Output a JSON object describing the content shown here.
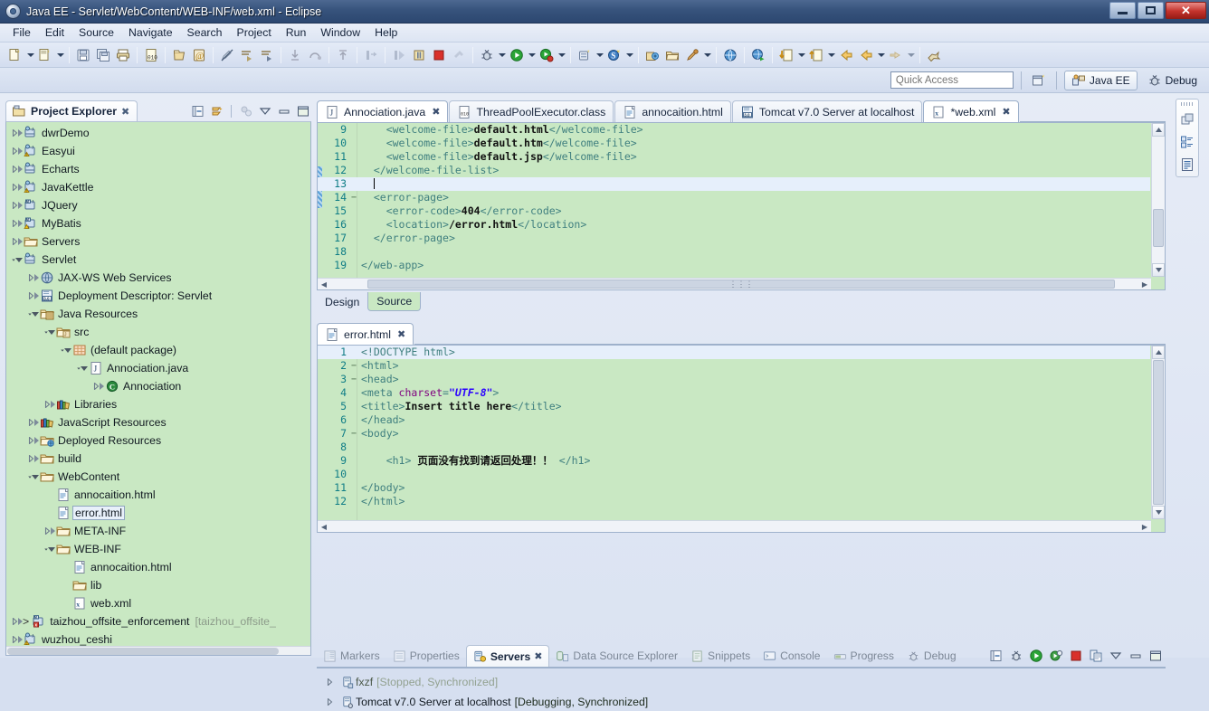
{
  "window": {
    "title": "Java EE - Servlet/WebContent/WEB-INF/web.xml - Eclipse",
    "minimize_label": "–",
    "maximize_label": "❐",
    "close_label": "✕"
  },
  "menu": {
    "items": [
      "File",
      "Edit",
      "Source",
      "Navigate",
      "Search",
      "Project",
      "Run",
      "Window",
      "Help"
    ]
  },
  "toolbar": {
    "buttons": [
      {
        "name": "new-wizard",
        "icon": "new-file-icon"
      },
      {
        "name": "new-wizard-dropdown",
        "icon": "chevron-down-icon"
      },
      {
        "name": "new-java-project",
        "icon": "new-project-icon"
      },
      {
        "name": "new-java-project-dropdown",
        "icon": "chevron-down-icon"
      },
      {
        "name": "save",
        "icon": "save-icon"
      },
      {
        "name": "save-all",
        "icon": "save-all-icon"
      },
      {
        "name": "print",
        "icon": "print-icon"
      },
      {
        "name": "toggle-breakpoint",
        "icon": "binary-icon"
      },
      {
        "name": "new-jsp",
        "icon": "document-icon"
      },
      {
        "name": "new-annotation",
        "icon": "at-sign-icon"
      },
      {
        "name": "link-with-editor",
        "icon": "pencil-off-icon"
      },
      {
        "name": "next-annotation",
        "icon": "next-annotation-icon"
      },
      {
        "name": "previous-annotation",
        "icon": "previous-annotation-icon"
      },
      {
        "name": "step-into",
        "icon": "step-into-icon"
      },
      {
        "name": "step-over",
        "icon": "step-over-icon"
      },
      {
        "name": "step-return",
        "icon": "step-return-icon"
      },
      {
        "name": "resume",
        "icon": "resume-icon"
      },
      {
        "name": "suspend",
        "icon": "suspend-icon"
      },
      {
        "name": "terminate",
        "icon": "terminate-icon"
      },
      {
        "name": "debug",
        "icon": "debug-bug-icon"
      },
      {
        "name": "debug-dropdown",
        "icon": "chevron-down-icon"
      },
      {
        "name": "run",
        "icon": "run-play-icon"
      },
      {
        "name": "run-dropdown",
        "icon": "chevron-down-icon"
      },
      {
        "name": "run-coverage",
        "icon": "coverage-icon"
      },
      {
        "name": "run-coverage-dropdown",
        "icon": "chevron-down-icon"
      },
      {
        "name": "new-server",
        "icon": "server-new-icon"
      },
      {
        "name": "new-server-dropdown",
        "icon": "chevron-down-icon"
      },
      {
        "name": "search-scoped",
        "icon": "search-s-icon"
      },
      {
        "name": "search-dropdown",
        "icon": "chevron-down-icon"
      },
      {
        "name": "open-type",
        "icon": "open-type-icon"
      },
      {
        "name": "open-task",
        "icon": "open-folder-icon"
      },
      {
        "name": "external-tools",
        "icon": "wrench-icon"
      },
      {
        "name": "external-tools-dropdown",
        "icon": "chevron-down-icon"
      },
      {
        "name": "open-web-browser",
        "icon": "globe-icon"
      },
      {
        "name": "open-web-browser-2",
        "icon": "globe-run-icon"
      },
      {
        "name": "previous-edit-location",
        "icon": "down-arrow-doc-icon"
      },
      {
        "name": "previous-edit-dropdown",
        "icon": "chevron-down-icon"
      },
      {
        "name": "next-edit-location",
        "icon": "up-arrow-doc-icon"
      },
      {
        "name": "next-edit-dropdown",
        "icon": "chevron-down-icon"
      },
      {
        "name": "back",
        "icon": "back-arrow-icon"
      },
      {
        "name": "forward-history",
        "icon": "forward-arrow-icon"
      },
      {
        "name": "forward-dropdown",
        "icon": "chevron-down-icon"
      },
      {
        "name": "forward",
        "icon": "right-arrow-icon"
      },
      {
        "name": "forward-2-dropdown",
        "icon": "chevron-down-icon"
      },
      {
        "name": "pin-editor",
        "icon": "pin-icon"
      }
    ]
  },
  "quick_access": {
    "placeholder": "Quick Access",
    "value": "",
    "open_perspective_icon": "open-perspective-icon",
    "perspectives": [
      {
        "label": "Java EE",
        "icon": "java-ee-icon",
        "active": true
      },
      {
        "label": "Debug",
        "icon": "debug-bug-icon",
        "active": false
      }
    ]
  },
  "project_explorer": {
    "tab_label": "Project Explorer",
    "close_label": "✖",
    "toolbar": [
      {
        "name": "collapse-all-button",
        "icon": "collapse-all-icon"
      },
      {
        "name": "link-with-editor-button",
        "icon": "link-editor-icon"
      },
      {
        "name": "focus-on-active-task-button",
        "icon": "focus-task-icon"
      },
      {
        "name": "view-menu-button",
        "icon": "triangle-down-icon"
      },
      {
        "name": "minimize-view-button",
        "icon": "minimize-icon"
      },
      {
        "name": "maximize-view-button",
        "icon": "maximize-icon"
      }
    ],
    "tree": [
      {
        "label": "dwrDemo",
        "indent": 0,
        "arrow": "collapsed",
        "icon": "java-web-project-icon"
      },
      {
        "label": "Easyui",
        "indent": 0,
        "arrow": "collapsed",
        "icon": "java-web-project-warn-icon"
      },
      {
        "label": "Echarts",
        "indent": 0,
        "arrow": "collapsed",
        "icon": "java-web-project-icon"
      },
      {
        "label": "JavaKettle",
        "indent": 0,
        "arrow": "collapsed",
        "icon": "java-web-project-warn-icon"
      },
      {
        "label": "JQuery",
        "indent": 0,
        "arrow": "collapsed",
        "icon": "maven-project-icon"
      },
      {
        "label": "MyBatis",
        "indent": 0,
        "arrow": "collapsed",
        "icon": "maven-project-warn-icon"
      },
      {
        "label": "Servers",
        "indent": 0,
        "arrow": "collapsed",
        "icon": "folder-icon"
      },
      {
        "label": "Servlet",
        "indent": 0,
        "arrow": "expanded",
        "icon": "java-web-project-icon"
      },
      {
        "label": "JAX-WS Web Services",
        "indent": 1,
        "arrow": "collapsed",
        "icon": "jaxws-icon"
      },
      {
        "label": "Deployment Descriptor: Servlet",
        "indent": 1,
        "arrow": "collapsed",
        "icon": "deployment-descriptor-icon"
      },
      {
        "label": "Java Resources",
        "indent": 1,
        "arrow": "expanded",
        "icon": "java-resources-icon"
      },
      {
        "label": "src",
        "indent": 2,
        "arrow": "expanded",
        "icon": "source-folder-icon"
      },
      {
        "label": "(default package)",
        "indent": 3,
        "arrow": "expanded",
        "icon": "package-icon"
      },
      {
        "label": "Annociation.java",
        "indent": 4,
        "arrow": "expanded",
        "icon": "java-file-icon"
      },
      {
        "label": "Annociation",
        "indent": 5,
        "arrow": "collapsed",
        "icon": "class-icon"
      },
      {
        "label": "Libraries",
        "indent": 2,
        "arrow": "collapsed",
        "icon": "libraries-icon"
      },
      {
        "label": "JavaScript Resources",
        "indent": 1,
        "arrow": "collapsed",
        "icon": "libraries-icon"
      },
      {
        "label": "Deployed Resources",
        "indent": 1,
        "arrow": "collapsed",
        "icon": "deployed-resources-icon"
      },
      {
        "label": "build",
        "indent": 1,
        "arrow": "collapsed",
        "icon": "folder-icon"
      },
      {
        "label": "WebContent",
        "indent": 1,
        "arrow": "expanded",
        "icon": "folder-icon"
      },
      {
        "label": "annocaition.html",
        "indent": 2,
        "arrow": "none",
        "icon": "html-file-icon"
      },
      {
        "label": "error.html",
        "indent": 2,
        "arrow": "none",
        "icon": "html-file-icon",
        "selected": true
      },
      {
        "label": "META-INF",
        "indent": 2,
        "arrow": "collapsed",
        "icon": "folder-icon"
      },
      {
        "label": "WEB-INF",
        "indent": 2,
        "arrow": "expanded",
        "icon": "folder-icon"
      },
      {
        "label": "annocaition.html",
        "indent": 3,
        "arrow": "none",
        "icon": "html-file-icon"
      },
      {
        "label": "lib",
        "indent": 3,
        "arrow": "none",
        "icon": "folder-icon"
      },
      {
        "label": "web.xml",
        "indent": 3,
        "arrow": "none",
        "icon": "xml-file-icon"
      },
      {
        "label": "taizhou_offsite_enforcement",
        "indent": 0,
        "arrow": "collapsed",
        "icon": "maven-project-error-icon",
        "prefix": ">",
        "suffix": "[taizhou_offsite_"
      },
      {
        "label": "wuzhou_ceshi",
        "indent": 0,
        "arrow": "collapsed",
        "icon": "java-web-project-warn-icon"
      }
    ]
  },
  "editor_top": {
    "tabs": [
      {
        "label": "Annociation.java",
        "icon": "java-file-icon",
        "active": true,
        "close": "✖"
      },
      {
        "label": "ThreadPoolExecutor.class",
        "icon": "class-file-icon",
        "active": false
      },
      {
        "label": "annocaition.html",
        "icon": "html-file-icon",
        "active": false
      },
      {
        "label": "Tomcat v7.0 Server at localhost",
        "icon": "server-icon",
        "active": false
      },
      {
        "label": "*web.xml",
        "icon": "xml-file-icon",
        "active": true,
        "close": "✖"
      }
    ],
    "lines": [
      {
        "num": "9",
        "fold": "",
        "html": "    <span class='tag'>&lt;welcome-file&gt;</span><span class='txt'>default.html</span><span class='tag'>&lt;/welcome-file&gt;</span>"
      },
      {
        "num": "10",
        "fold": "",
        "html": "    <span class='tag'>&lt;welcome-file&gt;</span><span class='txt'>default.htm</span><span class='tag'>&lt;/welcome-file&gt;</span>"
      },
      {
        "num": "11",
        "fold": "",
        "html": "    <span class='tag'>&lt;welcome-file&gt;</span><span class='txt'>default.jsp</span><span class='tag'>&lt;/welcome-file&gt;</span>"
      },
      {
        "num": "12",
        "fold": "",
        "html": "  <span class='tag'>&lt;/welcome-file-list&gt;</span>"
      },
      {
        "num": "13",
        "fold": "",
        "html": "  <span class='caret-bar'></span>",
        "highlight": true
      },
      {
        "num": "14",
        "fold": "−",
        "html": "  <span class='tag'>&lt;error-page&gt;</span>"
      },
      {
        "num": "15",
        "fold": "",
        "html": "    <span class='tag'>&lt;error-code&gt;</span><span class='txt'>404</span><span class='tag'>&lt;/error-code&gt;</span>"
      },
      {
        "num": "16",
        "fold": "",
        "html": "    <span class='tag'>&lt;location&gt;</span><span class='txt'>/error.html</span><span class='tag'>&lt;/location&gt;</span>"
      },
      {
        "num": "17",
        "fold": "",
        "html": "  <span class='tag'>&lt;/error-page&gt;</span>"
      },
      {
        "num": "18",
        "fold": "",
        "html": ""
      },
      {
        "num": "19",
        "fold": "",
        "html": "<span class='tag'>&lt;/web-app&gt;</span>"
      }
    ],
    "page_tabs": [
      {
        "label": "Design",
        "active": false
      },
      {
        "label": "Source",
        "active": true
      }
    ]
  },
  "editor_bottom": {
    "tabs": [
      {
        "label": "error.html",
        "icon": "html-file-icon",
        "active": true,
        "close": "✖"
      }
    ],
    "lines": [
      {
        "num": "1",
        "fold": "",
        "html": "<span class='dtd'>&lt;!DOCTYPE html&gt;</span>",
        "highlight": true
      },
      {
        "num": "2",
        "fold": "−",
        "html": "<span class='tag'>&lt;html&gt;</span>"
      },
      {
        "num": "3",
        "fold": "−",
        "html": "<span class='tag'>&lt;head&gt;</span>"
      },
      {
        "num": "4",
        "fold": "",
        "html": "<span class='tag'>&lt;meta </span><span class='attr'>charset</span><span class='tag'>=</span><span class='str'>\"UTF-8\"</span><span class='tag'>&gt;</span>"
      },
      {
        "num": "5",
        "fold": "",
        "html": "<span class='tag'>&lt;title&gt;</span><span class='txt'>Insert title here</span><span class='tag'>&lt;/title&gt;</span>"
      },
      {
        "num": "6",
        "fold": "",
        "html": "<span class='tag'>&lt;/head&gt;</span>"
      },
      {
        "num": "7",
        "fold": "−",
        "html": "<span class='tag'>&lt;body&gt;</span>"
      },
      {
        "num": "8",
        "fold": "",
        "html": ""
      },
      {
        "num": "9",
        "fold": "",
        "html": "    <span class='tag'>&lt;h1&gt;</span> <span class='txt'>页面没有找到请返回处理！！</span> <span class='tag'>&lt;/h1&gt;</span>"
      },
      {
        "num": "10",
        "fold": "",
        "html": ""
      },
      {
        "num": "11",
        "fold": "",
        "html": "<span class='tag'>&lt;/body&gt;</span>"
      },
      {
        "num": "12",
        "fold": "",
        "html": "<span class='tag'>&lt;/html&gt;</span>"
      }
    ]
  },
  "bottom_panel": {
    "tabs": [
      {
        "label": "Markers",
        "icon": "markers-icon",
        "active": false
      },
      {
        "label": "Properties",
        "icon": "properties-icon",
        "active": false
      },
      {
        "label": "Servers",
        "icon": "servers-icon",
        "active": true,
        "close": "✖"
      },
      {
        "label": "Data Source Explorer",
        "icon": "data-source-icon",
        "active": false
      },
      {
        "label": "Snippets",
        "icon": "snippets-icon",
        "active": false
      },
      {
        "label": "Console",
        "icon": "console-icon",
        "active": false
      },
      {
        "label": "Progress",
        "icon": "progress-icon",
        "active": false
      },
      {
        "label": "Debug",
        "icon": "debug-bug-icon",
        "active": false
      }
    ],
    "toolbar": [
      {
        "name": "collapse-all-button",
        "icon": "collapse-all-icon"
      },
      {
        "name": "debug-server-button",
        "icon": "debug-bug-icon"
      },
      {
        "name": "start-server-button",
        "icon": "run-play-icon"
      },
      {
        "name": "profile-server-button",
        "icon": "profile-icon"
      },
      {
        "name": "stop-server-button",
        "icon": "terminate-icon"
      },
      {
        "name": "publish-server-button",
        "icon": "publish-icon"
      },
      {
        "name": "view-menu-button",
        "icon": "triangle-down-icon"
      },
      {
        "name": "minimize-view-button",
        "icon": "minimize-icon"
      },
      {
        "name": "maximize-view-button",
        "icon": "maximize-icon"
      }
    ],
    "servers": [
      {
        "name": "fxzf",
        "status": "[Stopped, Synchronized]",
        "icon": "server-stopped-icon",
        "dim": true
      },
      {
        "name": "Tomcat v7.0 Server at localhost",
        "status": "[Debugging, Synchronized]",
        "icon": "server-debug-icon",
        "dim": false
      }
    ]
  },
  "right_bar": {
    "buttons": [
      {
        "name": "restore-button",
        "icon": "restore-icon"
      },
      {
        "name": "outline-view-button",
        "icon": "outline-icon"
      },
      {
        "name": "task-list-button",
        "icon": "task-list-icon"
      }
    ]
  },
  "colors": {
    "editor_background": "#c9e8c3",
    "title_bar": "#37537c",
    "selection": "#e6effb",
    "line_number": "#0f7d86",
    "tag": "#3f7f7f",
    "string": "#2a00ff",
    "attribute": "#7f007f"
  }
}
